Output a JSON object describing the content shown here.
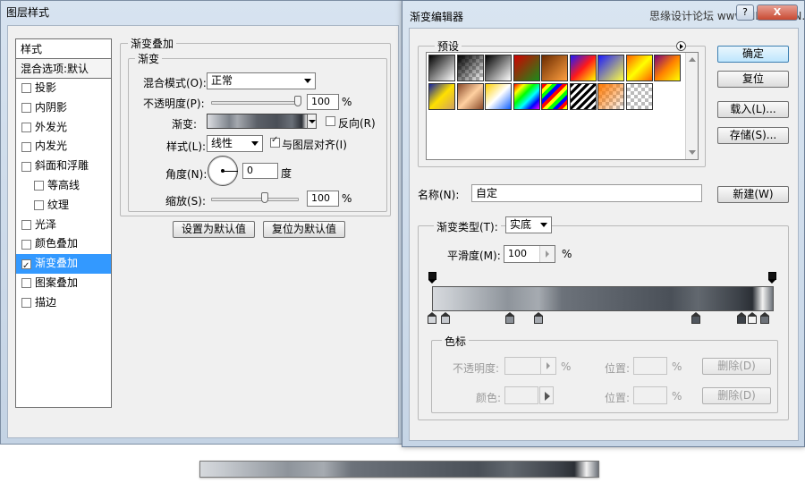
{
  "layer_style": {
    "title": "图层样式",
    "style_list": {
      "header": "样式",
      "blend_options": "混合选项:默认",
      "items": [
        {
          "label": "投影",
          "checked": false
        },
        {
          "label": "内阴影",
          "checked": false
        },
        {
          "label": "外发光",
          "checked": false
        },
        {
          "label": "内发光",
          "checked": false
        },
        {
          "label": "斜面和浮雕",
          "checked": false
        },
        {
          "label": "等高线",
          "checked": false
        },
        {
          "label": "纹理",
          "checked": false
        },
        {
          "label": "光泽",
          "checked": false
        },
        {
          "label": "颜色叠加",
          "checked": false
        },
        {
          "label": "渐变叠加",
          "checked": true,
          "active": true
        },
        {
          "label": "图案叠加",
          "checked": false
        },
        {
          "label": "描边",
          "checked": false
        }
      ]
    },
    "gradient_overlay": {
      "group_title": "渐变叠加",
      "sub_group_title": "渐变",
      "blend_mode_label": "混合模式(O):",
      "blend_mode_value": "正常",
      "opacity_label": "不透明度(P):",
      "opacity_value": "100",
      "opacity_unit": "%",
      "gradient_label": "渐变:",
      "reverse_label": "反向(R)",
      "reverse_checked": false,
      "style_label": "样式(L):",
      "style_value": "线性",
      "align_label": "与图层对齐(I)",
      "align_checked": true,
      "angle_label": "角度(N):",
      "angle_value": "0",
      "angle_unit": "度",
      "scale_label": "缩放(S):",
      "scale_value": "100",
      "scale_unit": "%"
    },
    "buttons": {
      "make_default": "设置为默认值",
      "reset_default": "复位为默认值"
    }
  },
  "gradient_editor": {
    "title": "渐变编辑器",
    "watermark": "思缘设计论坛  www.MISSYUAN.COM",
    "titlebar": {
      "help": "?",
      "close": "X"
    },
    "presets_label": "预设",
    "buttons": {
      "ok": "确定",
      "reset": "复位",
      "load": "载入(L)...",
      "save": "存储(S)...",
      "new": "新建(W)"
    },
    "name_label": "名称(N):",
    "name_value": "自定",
    "gradient_type_label": "渐变类型(T):",
    "gradient_type_value": "实底",
    "smoothness_label": "平滑度(M):",
    "smoothness_value": "100",
    "smoothness_unit": "%",
    "color_stops": {
      "group_title": "色标",
      "opacity_label": "不透明度:",
      "opacity_unit": "%",
      "location_label": "位置:",
      "location_unit": "%",
      "color_label": "颜色:",
      "delete_label": "删除(D)"
    }
  }
}
